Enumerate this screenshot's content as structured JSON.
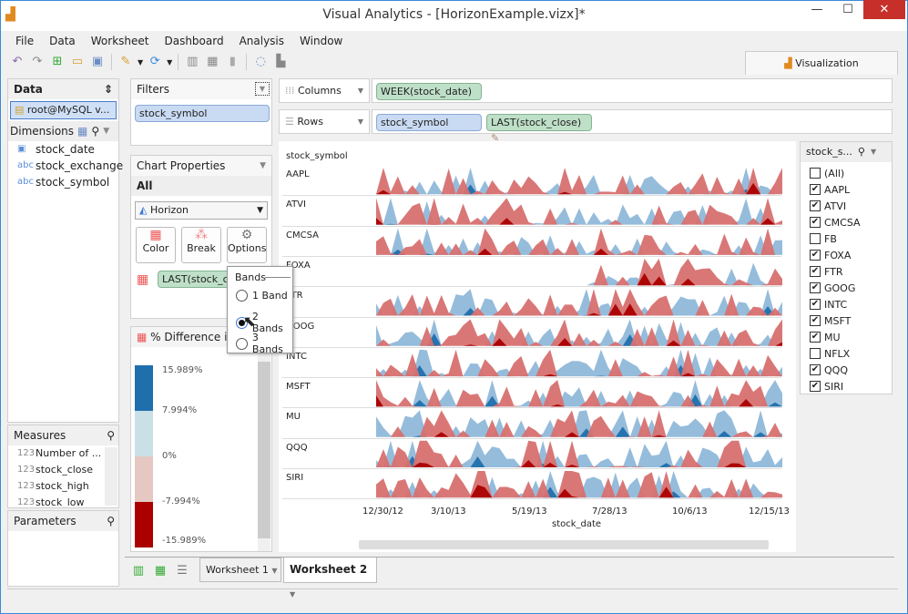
{
  "window": {
    "title": "Visual Analytics - [HorizonExample.vizx]*",
    "minimize": "—",
    "maximize": "☐",
    "close": "✕"
  },
  "menu": [
    "File",
    "Data",
    "Worksheet",
    "Dashboard",
    "Analysis",
    "Window"
  ],
  "toolbar": [
    "undo-icon",
    "redo-icon",
    "new-icon",
    "open-icon",
    "save-icon",
    "connect-icon",
    "refresh-icon",
    "new-worksheet-icon",
    "new-dashboard-icon",
    "chart-icon",
    "refresh-data-icon",
    "clear-icon"
  ],
  "viz_tab": "Visualization",
  "data_panel": {
    "title": "Data",
    "connection": "root@MySQL v...",
    "dimensions_label": "Dimensions",
    "dimensions": [
      {
        "icon": "date",
        "name": "stock_date"
      },
      {
        "icon": "abc",
        "name": "stock_exchange"
      },
      {
        "icon": "abc",
        "name": "stock_symbol"
      }
    ],
    "measures_label": "Measures",
    "measures": [
      "Number of ...",
      "stock_close",
      "stock_high",
      "stock_low"
    ],
    "parameters_label": "Parameters"
  },
  "filters": {
    "title": "Filters",
    "items": [
      "stock_symbol"
    ]
  },
  "chart_properties": {
    "title": "Chart Properties",
    "scope": "All",
    "chart_type": "Horizon",
    "buttons": [
      "Color",
      "Break",
      "Options"
    ],
    "color_field": "LAST(stock_close)"
  },
  "bands_popup": {
    "title": "Bands",
    "options": [
      "1 Band",
      "2 Bands",
      "3 Bands"
    ],
    "selected": "2 Bands"
  },
  "legend": {
    "title": "% Difference in L...",
    "labels": [
      "15.989%",
      "7.994%",
      "0%",
      "-7.994%",
      "-15.989%"
    ],
    "colors": [
      "#1f6fad",
      "#c9e0e7",
      "#e6c8c3",
      "#aa0000"
    ]
  },
  "shelves": {
    "columns_label": "Columns",
    "columns": [
      "WEEK(stock_date)"
    ],
    "rows_label": "Rows",
    "rows": [
      "stock_symbol",
      "LAST(stock_close)"
    ]
  },
  "chart": {
    "row_header": "stock_symbol",
    "rows": [
      "AAPL",
      "ATVI",
      "CMCSA",
      "FOXA",
      "FTR",
      "GOOG",
      "INTC",
      "MSFT",
      "MU",
      "QQQ",
      "SIRI"
    ],
    "x_ticks": [
      "12/30/12",
      "3/10/13",
      "5/19/13",
      "7/28/13",
      "10/6/13",
      "12/15/13"
    ],
    "x_label": "stock_date",
    "colors": {
      "pos1": "#8fb8d9",
      "pos2": "#1f6fad",
      "neg1": "#d77070",
      "neg2": "#aa0000"
    }
  },
  "symbol_filter": {
    "title": "stock_s...",
    "items": [
      {
        "label": "(All)",
        "checked": false
      },
      {
        "label": "AAPL",
        "checked": true
      },
      {
        "label": "ATVI",
        "checked": true
      },
      {
        "label": "CMCSA",
        "checked": true
      },
      {
        "label": "FB",
        "checked": false
      },
      {
        "label": "FOXA",
        "checked": true
      },
      {
        "label": "FTR",
        "checked": true
      },
      {
        "label": "GOOG",
        "checked": true
      },
      {
        "label": "INTC",
        "checked": true
      },
      {
        "label": "MSFT",
        "checked": true
      },
      {
        "label": "MU",
        "checked": true
      },
      {
        "label": "NFLX",
        "checked": false
      },
      {
        "label": "QQQ",
        "checked": true
      },
      {
        "label": "SIRI",
        "checked": true
      }
    ]
  },
  "sheets": [
    "Worksheet 1",
    "Worksheet 2"
  ],
  "active_sheet": "Worksheet 2"
}
